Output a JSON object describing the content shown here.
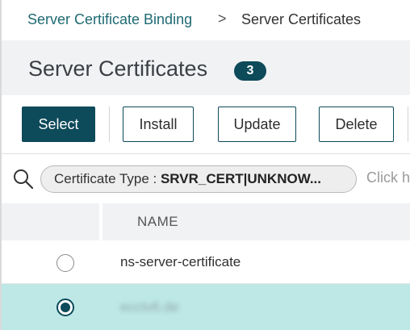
{
  "breadcrumb": {
    "parent": "Server Certificate Binding",
    "separator": ">",
    "current": "Server Certificates"
  },
  "header": {
    "title": "Server Certificates",
    "count": "3"
  },
  "toolbar": {
    "select_label": "Select",
    "install_label": "Install",
    "update_label": "Update",
    "delete_label": "Delete"
  },
  "search": {
    "icon": "search-icon",
    "filter_key": "Certificate Type : ",
    "filter_value": "SRVR_CERT|UNKNOW...",
    "hint": "Click h"
  },
  "table": {
    "columns": [
      "NAME"
    ],
    "rows": [
      {
        "name": "ns-server-certificate",
        "selected": false
      },
      {
        "name": "ecctv6.de",
        "selected": true
      }
    ]
  },
  "colors": {
    "accent": "#0d4a5a",
    "link": "#1f6a73",
    "selected_row": "#bde8e6",
    "header_bg": "#f1f2f4"
  }
}
